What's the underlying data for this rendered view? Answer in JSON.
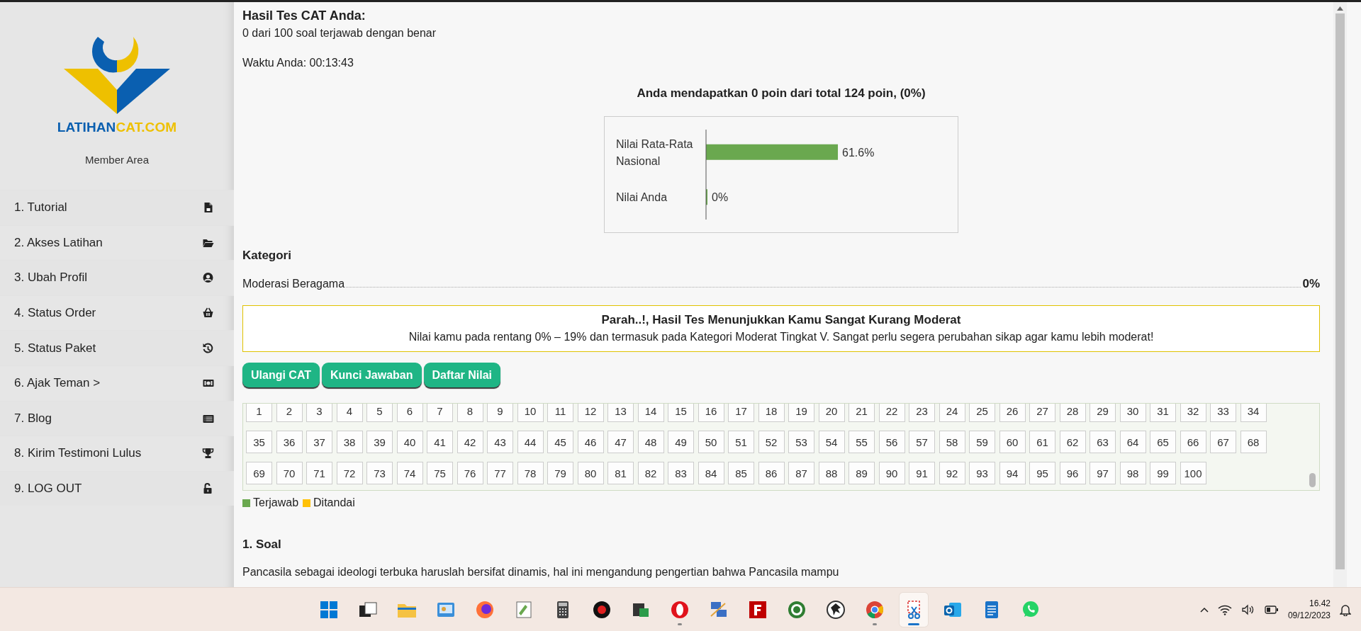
{
  "sidebar": {
    "logo": {
      "part_1": "LATIHAN",
      "part_2": "CAT.COM"
    },
    "caption": "Member Area",
    "items": [
      {
        "label": "1. Tutorial"
      },
      {
        "label": "2. Akses Latihan"
      },
      {
        "label": "3. Ubah Profil"
      },
      {
        "label": "4. Status Order"
      },
      {
        "label": "5. Status Paket"
      },
      {
        "label": "6. Ajak Teman >"
      },
      {
        "label": "7. Blog"
      },
      {
        "label": "8. Kirim Testimoni Lulus"
      },
      {
        "label": "9. LOG OUT"
      }
    ]
  },
  "result": {
    "title": "Hasil Tes CAT Anda:",
    "summary": "0 dari 100 soal terjawab dengan benar",
    "time": "Waktu Anda: 00:13:43",
    "points": "Anda mendapatkan 0 poin dari total 124 poin, (0%)",
    "chart_data": {
      "type": "bar",
      "orientation": "horizontal",
      "categories": [
        "Nilai Rata-Rata Nasional",
        "Nilai Anda"
      ],
      "series": [
        {
          "color": "#6aa84f",
          "values": [
            61.6,
            0
          ],
          "value_labels": [
            "61.6%",
            "0%"
          ]
        }
      ]
    }
  },
  "category": {
    "heading": "Kategori",
    "rows": [
      {
        "name": "Moderasi Beragama",
        "score": "0%"
      }
    ]
  },
  "verdict": {
    "title": "Parah..!, Hasil Tes Menunjukkan Kamu Sangat Kurang Moderat",
    "text": "Nilai kamu pada rentang 0% – 19% dan termasuk pada Kategori Moderat Tingkat V. Sangat perlu segera perubahan sikap agar kamu lebih moderat!"
  },
  "buttons": [
    "Ulangi CAT",
    "Kunci Jawaban",
    "Daftar Nilai"
  ],
  "questions": [
    {
      "number": "1",
      "answered": false
    },
    {
      "number": "2",
      "answered": false
    },
    {
      "number": "3",
      "answered": false
    },
    {
      "number": "4",
      "answered": false
    },
    {
      "number": "5",
      "answered": false
    },
    {
      "number": "6",
      "answered": false
    },
    {
      "number": "7",
      "answered": false
    },
    {
      "number": "8",
      "answered": false
    },
    {
      "number": "9",
      "answered": false
    },
    {
      "number": "10",
      "answered": false
    },
    {
      "number": "11",
      "answered": false
    },
    {
      "number": "12",
      "answered": false
    },
    {
      "number": "13",
      "answered": false
    },
    {
      "number": "14",
      "answered": false
    },
    {
      "number": "15",
      "answered": false
    },
    {
      "number": "16",
      "answered": false
    },
    {
      "number": "17",
      "answered": false
    },
    {
      "number": "18",
      "answered": false
    },
    {
      "number": "19",
      "answered": false
    },
    {
      "number": "20",
      "answered": false
    },
    {
      "number": "21",
      "answered": false
    },
    {
      "number": "22",
      "answered": false
    },
    {
      "number": "23",
      "answered": false
    },
    {
      "number": "24",
      "answered": false
    },
    {
      "number": "25",
      "answered": false
    },
    {
      "number": "26",
      "answered": false
    },
    {
      "number": "27",
      "answered": false
    },
    {
      "number": "28",
      "answered": false
    },
    {
      "number": "29",
      "answered": false
    },
    {
      "number": "30",
      "answered": false
    },
    {
      "number": "31",
      "answered": false
    },
    {
      "number": "32",
      "answered": false
    },
    {
      "number": "33",
      "answered": false
    },
    {
      "number": "34",
      "answered": false
    },
    {
      "number": "35",
      "answered": false
    },
    {
      "number": "36",
      "answered": false
    },
    {
      "number": "37",
      "answered": false
    },
    {
      "number": "38",
      "answered": false
    },
    {
      "number": "39",
      "answered": false
    },
    {
      "number": "40",
      "answered": false
    },
    {
      "number": "41",
      "answered": false
    },
    {
      "number": "42",
      "answered": false
    },
    {
      "number": "43",
      "answered": false
    },
    {
      "number": "44",
      "answered": false
    },
    {
      "number": "45",
      "answered": false
    },
    {
      "number": "46",
      "answered": false
    },
    {
      "number": "47",
      "answered": false
    },
    {
      "number": "48",
      "answered": false
    },
    {
      "number": "49",
      "answered": false
    },
    {
      "number": "50",
      "answered": false
    },
    {
      "number": "51",
      "answered": false
    },
    {
      "number": "52",
      "answered": false
    },
    {
      "number": "53",
      "answered": false
    },
    {
      "number": "54",
      "answered": false
    },
    {
      "number": "55",
      "answered": false
    },
    {
      "number": "56",
      "answered": false
    },
    {
      "number": "57",
      "answered": false
    },
    {
      "number": "58",
      "answered": false
    },
    {
      "number": "59",
      "answered": false
    },
    {
      "number": "60",
      "answered": false
    },
    {
      "number": "61",
      "answered": false
    },
    {
      "number": "62",
      "answered": false
    },
    {
      "number": "63",
      "answered": false
    },
    {
      "number": "64",
      "answered": false
    },
    {
      "number": "65",
      "answered": false
    },
    {
      "number": "66",
      "answered": false
    },
    {
      "number": "67",
      "answered": false
    },
    {
      "number": "68",
      "answered": false
    },
    {
      "number": "69",
      "answered": false
    },
    {
      "number": "70",
      "answered": false
    },
    {
      "number": "71",
      "answered": false
    },
    {
      "number": "72",
      "answered": false
    },
    {
      "number": "73",
      "answered": false
    },
    {
      "number": "74",
      "answered": false
    },
    {
      "number": "75",
      "answered": false
    },
    {
      "number": "76",
      "answered": false
    },
    {
      "number": "77",
      "answered": false
    },
    {
      "number": "78",
      "answered": false
    },
    {
      "number": "79",
      "answered": false
    },
    {
      "number": "80",
      "answered": false
    },
    {
      "number": "81",
      "answered": false
    },
    {
      "number": "82",
      "answered": false
    },
    {
      "number": "83",
      "answered": false
    },
    {
      "number": "84",
      "answered": false
    },
    {
      "number": "85",
      "answered": false
    },
    {
      "number": "86",
      "answered": false
    },
    {
      "number": "87",
      "answered": false
    },
    {
      "number": "88",
      "answered": false
    },
    {
      "number": "89",
      "answered": false
    },
    {
      "number": "90",
      "answered": false
    },
    {
      "number": "91",
      "answered": false
    },
    {
      "number": "92",
      "answered": false
    },
    {
      "number": "93",
      "answered": false
    },
    {
      "number": "94",
      "answered": false
    },
    {
      "number": "95",
      "answered": false
    },
    {
      "number": "96",
      "answered": false
    },
    {
      "number": "97",
      "answered": false
    },
    {
      "number": "98",
      "answered": false
    },
    {
      "number": "99",
      "answered": false
    },
    {
      "number": "100",
      "answered": false
    }
  ],
  "legend": [
    {
      "label": "Terjawab",
      "color": "#6aa84f"
    },
    {
      "label": "Ditandai",
      "color": "#ffc107"
    }
  ],
  "question": {
    "heading": "1. Soal",
    "text": "Pancasila sebagai ideologi terbuka haruslah bersifat dinamis, hal ini mengandung pengertian bahwa Pancasila mampu"
  },
  "taskbar": {
    "apps": [
      {
        "running": false,
        "selected": false
      },
      {
        "running": false,
        "selected": false
      },
      {
        "running": false,
        "selected": false
      },
      {
        "running": false,
        "selected": false
      },
      {
        "running": false,
        "selected": false
      },
      {
        "running": false,
        "selected": false
      },
      {
        "running": false,
        "selected": false
      },
      {
        "running": false,
        "selected": false
      },
      {
        "running": false,
        "selected": false
      },
      {
        "running": true,
        "selected": false
      },
      {
        "running": false,
        "selected": false
      },
      {
        "running": false,
        "selected": false
      },
      {
        "running": false,
        "selected": false
      },
      {
        "running": false,
        "selected": false
      },
      {
        "running": true,
        "selected": false
      },
      {
        "running": true,
        "selected": true
      },
      {
        "running": false,
        "selected": false
      },
      {
        "running": false,
        "selected": false
      },
      {
        "running": false,
        "selected": false
      }
    ],
    "time": "16.42",
    "date": "09/12/2023"
  }
}
